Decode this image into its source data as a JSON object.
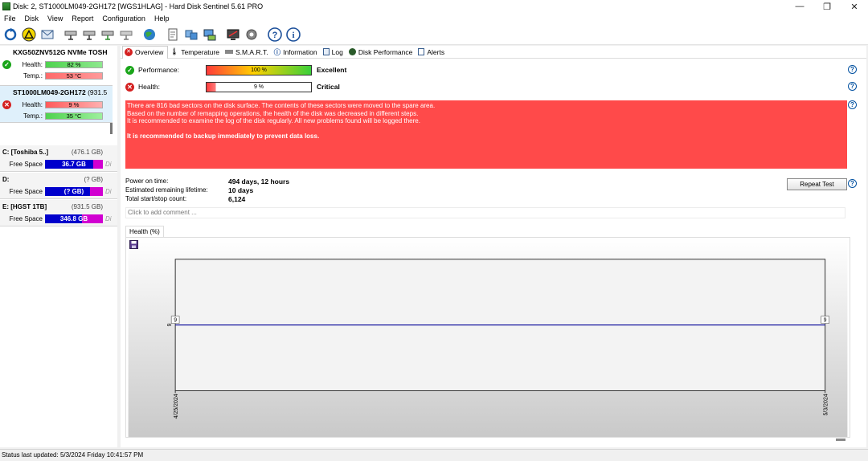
{
  "window": {
    "title": "Disk: 2, ST1000LM049-2GH172 [WGS1HLAG]  -  Hard Disk Sentinel 5.61 PRO",
    "controls": {
      "minimize": "—",
      "maximize": "❐",
      "close": "✕"
    }
  },
  "menu": [
    "File",
    "Disk",
    "View",
    "Report",
    "Configuration",
    "Help"
  ],
  "toolbar": {
    "icons": [
      "refresh-icon",
      "warning-icon",
      "email-icon",
      "disk-tool-icon",
      "disk-tool-icon",
      "disk-tool-icon",
      "disk-tool-icon",
      "globe-icon",
      "clipboard-icon",
      "transfer-icon",
      "network-icon",
      "monitor-icon",
      "gear-icon",
      "help-icon",
      "info-icon"
    ]
  },
  "disks": [
    {
      "name": "KXG50ZNV512G NVMe TOSH",
      "health_label": "Health:",
      "health": "82 %",
      "health_value": 82,
      "temp_label": "Temp.:",
      "temp": "53 °C",
      "status": "ok"
    },
    {
      "name": "ST1000LM049-2GH172",
      "size_hint": "(931.5",
      "health_label": "Health:",
      "health": "9 %",
      "health_value": 9,
      "temp_label": "Temp.:",
      "temp": "35 °C",
      "status": "critical"
    }
  ],
  "volumes": [
    {
      "name": "C: [Toshiba 5..]",
      "size": "(476.1 GB)",
      "free_label": "Free Space",
      "free": "36.7 GB",
      "used_fraction": 0.92,
      "tail": "Di"
    },
    {
      "name": "D:",
      "size": "(? GB)",
      "free_label": "Free Space",
      "free": "(? GB)",
      "used_fraction": 0.85,
      "tail": "Di"
    },
    {
      "name": "E: [HGST 1TB]",
      "size": "(931.5 GB)",
      "free_label": "Free Space",
      "free": "346.8 GB",
      "used_fraction": 0.63,
      "tail": "Di"
    }
  ],
  "tabs": [
    "Overview",
    "Temperature",
    "S.M.A.R.T.",
    "Information",
    "Log",
    "Disk Performance",
    "Alerts"
  ],
  "overview": {
    "performance_label": "Performance:",
    "performance": "100 %",
    "performance_value": 100,
    "performance_status": "Excellent",
    "health_label": "Health:",
    "health": "9 %",
    "health_value": 9,
    "health_status": "Critical",
    "message_lines": [
      "There are 816 bad sectors on the disk surface. The contents of these sectors were moved to the spare area.",
      "Based on the number of remapping operations, the health of the disk was decreased in different steps.",
      "It is recommended to examine the log of the disk regularly. All new problems found will be logged there."
    ],
    "message_strong": "It is recommended to backup immediately to prevent data loss.",
    "power_on_label": "Power on time:",
    "power_on": "494 days, 12 hours",
    "remaining_label": "Estimated remaining lifetime:",
    "remaining": "10 days",
    "startstop_label": "Total start/stop count:",
    "startstop": "6,124",
    "repeat_test": "Repeat Test",
    "comment_placeholder": "Click to add comment ...",
    "chart_tab": "Health (%)"
  },
  "chart_data": {
    "type": "line",
    "x": [
      "4/25/2024",
      "5/3/2024"
    ],
    "series": [
      {
        "values": [
          9,
          9
        ]
      }
    ],
    "data_labels": [
      "9",
      "9"
    ],
    "ylabel": "9",
    "grid": false,
    "color": "#1a1aa0"
  },
  "status": "Status last updated: 5/3/2024 Friday 10:41:57 PM",
  "colors": {
    "critical": "#ff4a4a",
    "ok_green": "#1aa51a",
    "bar_blue": "#0000cc",
    "bar_pink": "#d100d1"
  }
}
